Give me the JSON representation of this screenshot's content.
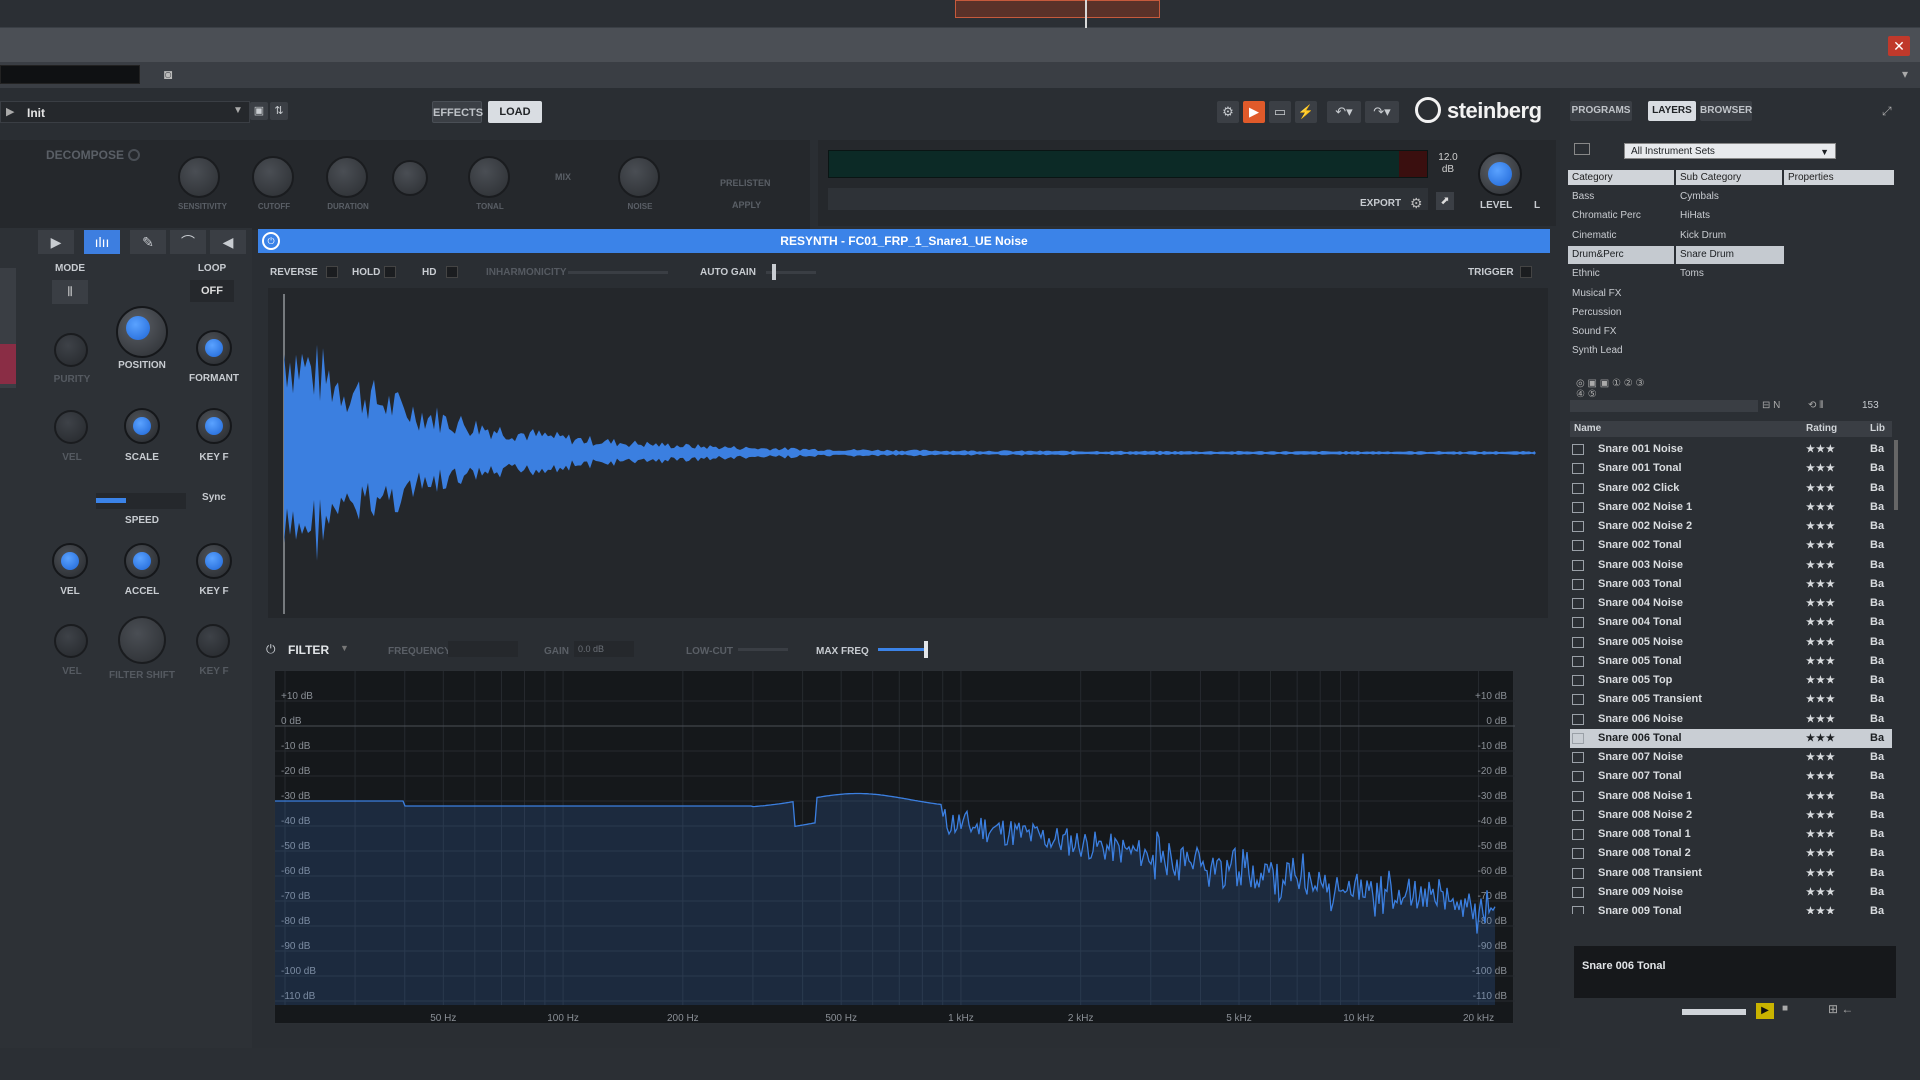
{
  "toolbar": {
    "preset_name": "Init",
    "effects_label": "EFFECTS",
    "load_label": "LOAD",
    "brand": "steinberg"
  },
  "decompose": {
    "title": "DECOMPOSE",
    "knobs": [
      "SENSITIVITY",
      "CUTOFF",
      "DURATION",
      "TONAL",
      "NOISE"
    ],
    "mix_label": "MIX",
    "preview_label": "PRELISTEN",
    "apply_label": "APPLY"
  },
  "meter": {
    "value": "12.0",
    "unit": "dB",
    "export_label": "EXPORT",
    "level_label": "LEVEL",
    "lr_label": "L"
  },
  "left_panel": {
    "mode_label": "MODE",
    "loop_label": "LOOP",
    "loop_value": "OFF",
    "knobs": {
      "purity": "PURITY",
      "position": "POSITION",
      "formant": "FORMANT",
      "vel_top": "VEL",
      "scale": "SCALE",
      "keyf1": "KEY F",
      "sync": "Sync",
      "speed": "SPEED",
      "vel": "VEL",
      "accel": "ACCEL",
      "keyf2": "KEY F",
      "vel_dim": "VEL",
      "filter_shift": "FILTER SHIFT",
      "keyf_dim": "KEY F"
    }
  },
  "editor": {
    "title": "RESYNTH - FC01_FRP_1_Snare1_UE Noise",
    "options": {
      "reverse": "REVERSE",
      "hold": "HOLD",
      "hd": "HD",
      "inharmonicity": "INHARMONICITY",
      "auto_gain": "AUTO GAIN",
      "trigger": "TRIGGER"
    }
  },
  "filter": {
    "title": "FILTER",
    "frequency_label": "FREQUENCY",
    "gain_label": "GAIN",
    "gain_value": "0.0 dB",
    "lowcut_label": "LOW-CUT",
    "maxfreq_label": "MAX FREQ"
  },
  "spectrum": {
    "db_labels": [
      "+10 dB",
      "0 dB",
      "-10 dB",
      "-20 dB",
      "-30 dB",
      "-40 dB",
      "-50 dB",
      "-60 dB",
      "-70 dB",
      "-80 dB",
      "-90 dB",
      "-100 dB",
      "-110 dB"
    ],
    "freq_labels": [
      "50 Hz",
      "100 Hz",
      "200 Hz",
      "500 Hz",
      "1 kHz",
      "2 kHz",
      "5 kHz",
      "10 kHz",
      "20 kHz"
    ]
  },
  "browser": {
    "tabs": [
      "PROGRAMS",
      "LAYERS",
      "BROWSER"
    ],
    "active_tab": "LAYERS",
    "instrument_set": "All Instrument Sets",
    "col_category": "Category",
    "col_subcategory": "Sub Category",
    "col_properties": "Properties",
    "categories": [
      "Bass",
      "Chromatic Perc",
      "Cinematic",
      "Drum&Perc",
      "Ethnic",
      "Musical FX",
      "Percussion",
      "Sound FX",
      "Synth Lead"
    ],
    "selected_category": "Drum&Perc",
    "subcategories": [
      "Cymbals",
      "HiHats",
      "Kick Drum",
      "Snare Drum",
      "Toms"
    ],
    "selected_subcategory": "Snare Drum",
    "count": "153",
    "list_header": {
      "name": "Name",
      "rating": "Rating",
      "library": "Lib"
    },
    "rows": [
      {
        "name": "Snare 001 Noise",
        "rating": "★★★",
        "lib": "Ba"
      },
      {
        "name": "Snare 001 Tonal",
        "rating": "★★★",
        "lib": "Ba"
      },
      {
        "name": "Snare 002 Click",
        "rating": "★★★",
        "lib": "Ba"
      },
      {
        "name": "Snare 002 Noise 1",
        "rating": "★★★",
        "lib": "Ba"
      },
      {
        "name": "Snare 002 Noise 2",
        "rating": "★★★",
        "lib": "Ba"
      },
      {
        "name": "Snare 002 Tonal",
        "rating": "★★★",
        "lib": "Ba"
      },
      {
        "name": "Snare 003 Noise",
        "rating": "★★★",
        "lib": "Ba"
      },
      {
        "name": "Snare 003 Tonal",
        "rating": "★★★",
        "lib": "Ba"
      },
      {
        "name": "Snare 004 Noise",
        "rating": "★★★",
        "lib": "Ba"
      },
      {
        "name": "Snare 004 Tonal",
        "rating": "★★★",
        "lib": "Ba"
      },
      {
        "name": "Snare 005 Noise",
        "rating": "★★★",
        "lib": "Ba"
      },
      {
        "name": "Snare 005 Tonal",
        "rating": "★★★",
        "lib": "Ba"
      },
      {
        "name": "Snare 005 Top",
        "rating": "★★★",
        "lib": "Ba"
      },
      {
        "name": "Snare 005 Transient",
        "rating": "★★★",
        "lib": "Ba"
      },
      {
        "name": "Snare 006 Noise",
        "rating": "★★★",
        "lib": "Ba"
      },
      {
        "name": "Snare 006 Tonal",
        "rating": "★★★",
        "lib": "Ba"
      },
      {
        "name": "Snare 007 Noise",
        "rating": "★★★",
        "lib": "Ba"
      },
      {
        "name": "Snare 007 Tonal",
        "rating": "★★★",
        "lib": "Ba"
      },
      {
        "name": "Snare 008 Noise 1",
        "rating": "★★★",
        "lib": "Ba"
      },
      {
        "name": "Snare 008 Noise 2",
        "rating": "★★★",
        "lib": "Ba"
      },
      {
        "name": "Snare 008 Tonal 1",
        "rating": "★★★",
        "lib": "Ba"
      },
      {
        "name": "Snare 008 Tonal 2",
        "rating": "★★★",
        "lib": "Ba"
      },
      {
        "name": "Snare 008 Transient",
        "rating": "★★★",
        "lib": "Ba"
      },
      {
        "name": "Snare 009 Noise",
        "rating": "★★★",
        "lib": "Ba"
      },
      {
        "name": "Snare 009 Tonal",
        "rating": "★★★",
        "lib": "Ba"
      }
    ],
    "selected_row": "Snare 006 Tonal",
    "selected_info": "Snare 006 Tonal"
  },
  "colors": {
    "accent": "#3b83e8",
    "waveform": "#3b7fe0",
    "panel": "#2a2e33",
    "close": "#c0392b"
  }
}
